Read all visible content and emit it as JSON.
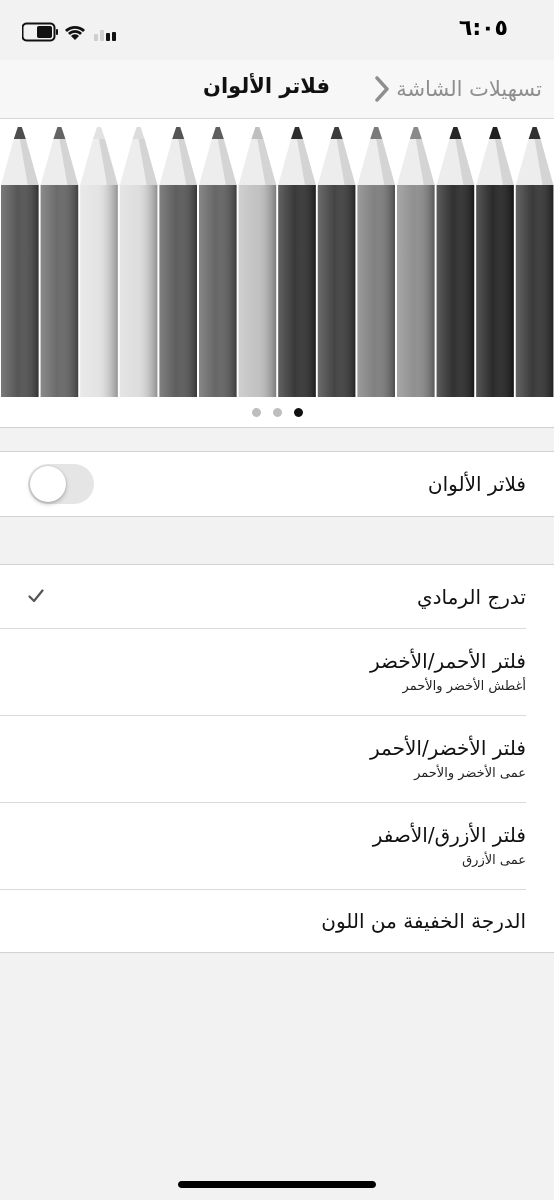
{
  "status_bar": {
    "time": "٦:٠٥",
    "icons": [
      "battery-icon",
      "wifi-icon",
      "cellular-signal-icon"
    ]
  },
  "nav": {
    "back_label": "تسهيلات الشاشة",
    "title": "فلاتر الألوان"
  },
  "preview": {
    "pencil_colors": [
      "#4d4d4d",
      "#636363",
      "#e2e2e2",
      "#dcdcdc",
      "#555555",
      "#5e5e5e",
      "#bfbfbf",
      "#2e2e2e",
      "#3a3a3a",
      "#7a7a7a",
      "#8a8a8a",
      "#262626",
      "#1f1f1f",
      "#303030"
    ],
    "page_count": 3,
    "active_page": 3
  },
  "color_filters": {
    "label": "فلاتر الألوان",
    "enabled": false
  },
  "filters": [
    {
      "title": "تدرج الرمادي",
      "subtitle": "",
      "selected": true
    },
    {
      "title": "فلتر الأحمر/الأخضر",
      "subtitle": "أغطش الأخضر والأحمر",
      "selected": false
    },
    {
      "title": "فلتر الأخضر/الأحمر",
      "subtitle": "عمى الأخضر والأحمر",
      "selected": false
    },
    {
      "title": "فلتر الأزرق/الأصفر",
      "subtitle": "عمى الأزرق",
      "selected": false
    },
    {
      "title": "الدرجة الخفيفة من اللون",
      "subtitle": "",
      "selected": false
    }
  ]
}
